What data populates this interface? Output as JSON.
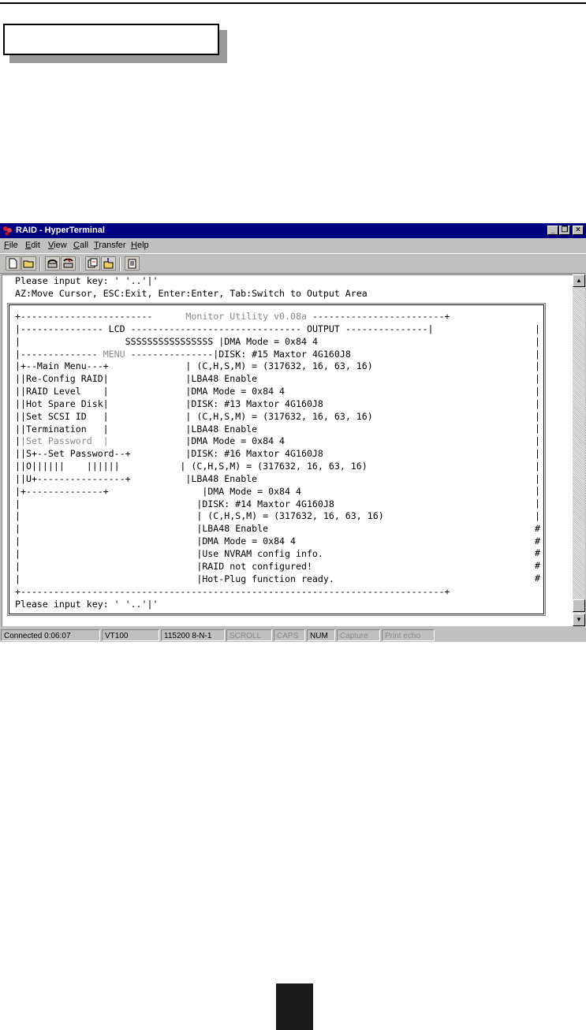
{
  "window": {
    "title": "RAID - HyperTerminal"
  },
  "menu": [
    "File",
    "Edit",
    "View",
    "Call",
    "Transfer",
    "Help"
  ],
  "toolbar": {
    "buttons": [
      "new-icon",
      "open-icon",
      "connect-icon",
      "disconnect-icon",
      "send-icon",
      "receive-icon",
      "properties-icon"
    ]
  },
  "terminal": {
    "header_lines": [
      "Please input key: ' '..'|'",
      "AZ:Move Cursor, ESC:Exit, Enter:Enter, Tab:Switch to Output Area"
    ],
    "title": "Monitor Utility v0.08a",
    "lcd_label": "LCD",
    "output_label": "OUTPUT",
    "lcd_value": "SSSSSSSSSSSSSSSS",
    "menu_label": "MENU",
    "menu_items": [
      "+--Main Menu---+",
      "|Re-Config RAID|",
      "|RAID Level    |",
      "|Hot Spare Disk|",
      "|Set SCSI ID   |",
      "|Termination   |",
      "|Set Password  |",
      "|S+--Set Password--+",
      "|O||||||    ||||||",
      "|U+----------------+",
      "+--------------+"
    ],
    "output_lines": [
      "DMA Mode = 0x84 4",
      "DISK: #15 Maxtor 4G160J8",
      " (C,H,S,M) = (317632, 16, 63, 16)",
      "LBA48 Enable",
      "DMA Mode = 0x84 4",
      "DISK: #13 Maxtor 4G160J8",
      " (C,H,S,M) = (317632, 16, 63, 16)",
      "LBA48 Enable",
      "DMA Mode = 0x84 4",
      "DISK: #16 Maxtor 4G160J8",
      " (C,H,S,M) = (317632, 16, 63, 16)",
      "LBA48 Enable",
      "DMA Mode = 0x84 4",
      "DISK: #14 Maxtor 4G160J8",
      " (C,H,S,M) = (317632, 16, 63, 16)",
      "LBA48 Enable",
      "DMA Mode = 0x84 4",
      "Use NVRAM config info.",
      "RAID not configured!",
      "Hot-Plug function ready."
    ],
    "prompt": "Please input key: ' '..'|'"
  },
  "status": {
    "connected": "Connected 0:06:07",
    "emulation": "VT100",
    "port": "115200 8-N-1",
    "scroll": "SCROLL",
    "caps": "CAPS",
    "num": "NUM",
    "capture": "Capture",
    "print_echo": "Print echo"
  }
}
